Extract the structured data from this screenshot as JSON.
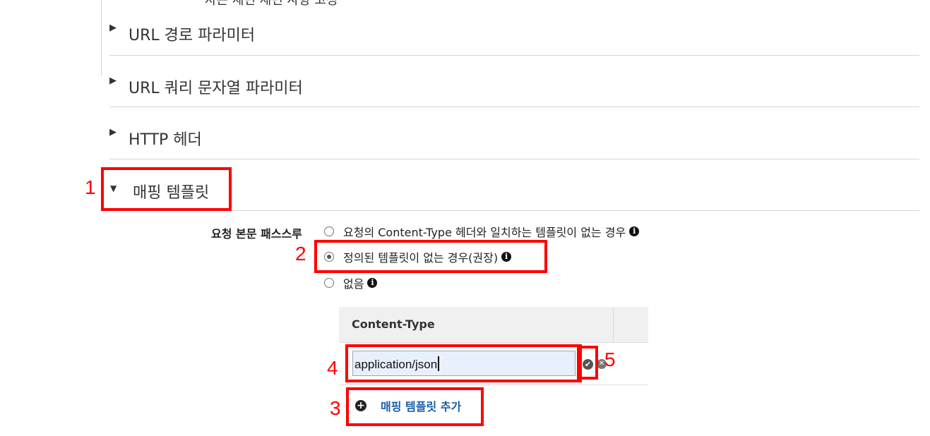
{
  "top_partial_text": "자는 세번 세번 사항 고정",
  "sections": [
    {
      "label": "URL 경로 파라미터",
      "caret": "▶"
    },
    {
      "label": "URL 쿼리 문자열 파라미터",
      "caret": "▶"
    },
    {
      "label": "HTTP 헤더",
      "caret": "▶"
    },
    {
      "label": "매핑 템플릿",
      "caret": "▼"
    }
  ],
  "passthrough": {
    "label": "요청 본문 패스스루",
    "options": [
      {
        "text": "요청의 Content-Type 헤더와 일치하는 템플릿이 없는 경우",
        "checked": false
      },
      {
        "text": "정의된 템플릿이 없는 경우(권장)",
        "checked": true
      },
      {
        "text": "없음",
        "checked": false
      }
    ],
    "info_icon": "info-icon"
  },
  "table": {
    "header": "Content-Type",
    "input_value": "application/json"
  },
  "add_template_label": "매핑 템플릿 추가",
  "annotations": [
    "1",
    "2",
    "3",
    "4",
    "5"
  ],
  "colors": {
    "highlight": "#ff0000",
    "link": "#1a5fa8",
    "input_bg": "#e8f0fe"
  }
}
